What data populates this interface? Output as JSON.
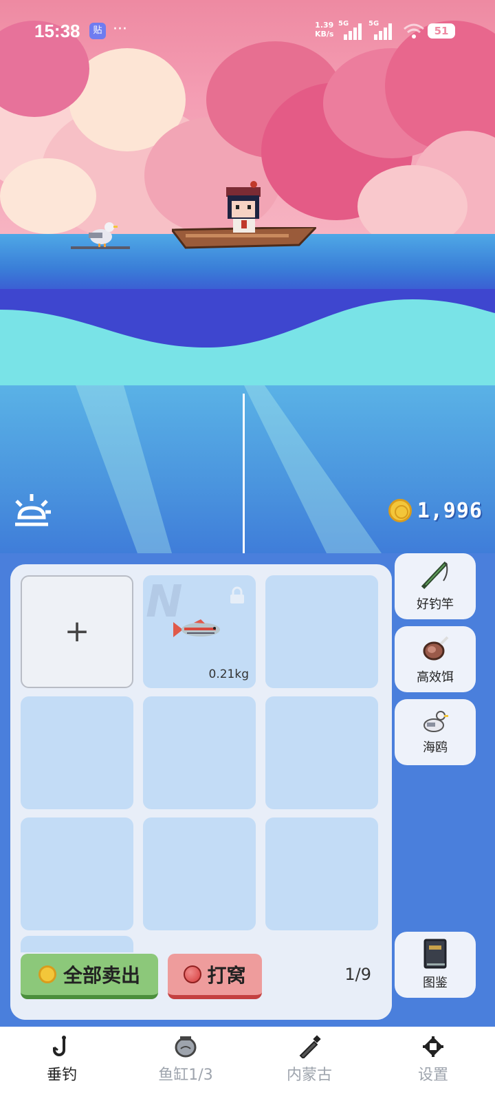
{
  "status_bar": {
    "time": "15:38",
    "app_badge": "贴",
    "more": "···",
    "net_speed_value": "1.39",
    "net_speed_unit": "KB/s",
    "sim1_label": "5G",
    "sim2_label": "5G",
    "battery": "51"
  },
  "hud": {
    "coins": "1,996",
    "weather_icon": "sun-icon"
  },
  "inventory": {
    "add_label": "+",
    "fish_weight": "0.21kg",
    "slot_count": 9,
    "page_indicator": "1/9"
  },
  "actions": {
    "sell_all": "全部卖出",
    "bait": "打窝"
  },
  "side_buttons": [
    {
      "label": "好钓竿",
      "icon": "fishing-rod-icon"
    },
    {
      "label": "高效饵",
      "icon": "meat-bait-icon"
    },
    {
      "label": "海鸥",
      "icon": "seagull-icon"
    },
    {
      "label": "图鉴",
      "icon": "book-icon"
    }
  ],
  "tabs": [
    {
      "label": "垂钓",
      "icon": "hook-icon",
      "active": true
    },
    {
      "label": "鱼缸1/3",
      "icon": "fish-tank-icon",
      "active": false
    },
    {
      "label": "内蒙古",
      "icon": "bottle-icon",
      "active": false
    },
    {
      "label": "设置",
      "icon": "settings-icon",
      "active": false
    }
  ],
  "colors": {
    "sky": "#ee8aa2",
    "sea": "#3e46cf",
    "panel": "#4a7fdc",
    "sell_button": "#8cc87a",
    "bait_button": "#ee9c9c"
  }
}
